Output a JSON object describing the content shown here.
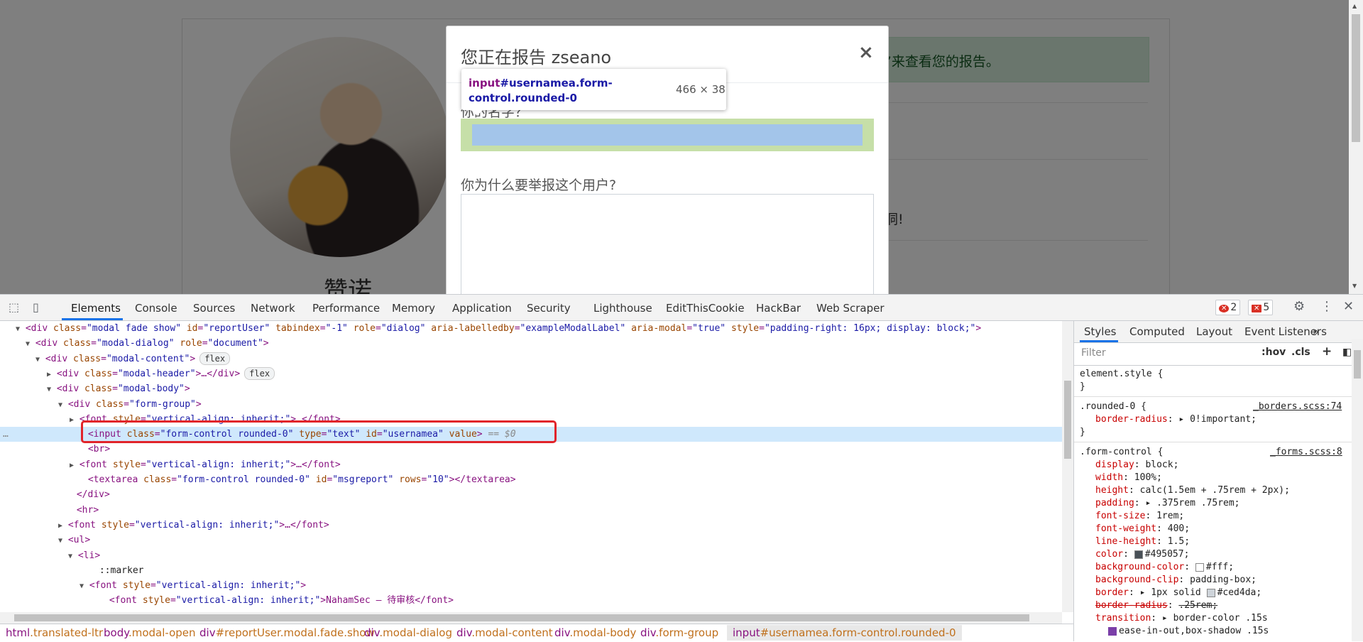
{
  "page": {
    "profile_name": "赞诺",
    "alert_text": "”来查看您的报告。",
    "side_text": "洞!"
  },
  "modal": {
    "title": "您正在报告 zseano",
    "close": "×",
    "label_username": "你的名字？",
    "label_reason": "你为什么要举报这个用户?"
  },
  "tooltip": {
    "tag": "input",
    "selector_rest": "#usernamea.form-control.rounded-0",
    "size": "466 × 38"
  },
  "devtools": {
    "tabs": [
      "Elements",
      "Console",
      "Sources",
      "Network",
      "Performance",
      "Memory",
      "Application",
      "Security",
      "Lighthouse",
      "EditThisCookie",
      "HackBar",
      "Web Scraper"
    ],
    "errors_count": "2",
    "issues_count": "5",
    "selected_marker": "== $0",
    "ellipsis": "…",
    "flex": "flex",
    "breadcrumbs": [
      {
        "tag": "html",
        "cls": ".translated-ltr"
      },
      {
        "tag": "body",
        "cls": ".modal-open"
      },
      {
        "tag": "div",
        "cls": "#reportUser.modal.fade.show"
      },
      {
        "tag": "div",
        "cls": ".modal-dialog"
      },
      {
        "tag": "div",
        "cls": ".modal-content"
      },
      {
        "tag": "div",
        "cls": ".modal-body"
      },
      {
        "tag": "div",
        "cls": ".form-group"
      },
      {
        "tag": "input",
        "cls": "#usernamea.form-control.rounded-0"
      }
    ],
    "dom_lines": [
      "<div class=\"modal fade show\" id=\"reportUser\" tabindex=\"-1\" role=\"dialog\" aria-labelledby=\"exampleModalLabel\" aria-modal=\"true\" style=\"padding-right: 16px; display: block;\">",
      "<div class=\"modal-dialog\" role=\"document\">",
      "<div class=\"modal-content\">",
      "<div class=\"modal-header\">…</div>",
      "<div class=\"modal-body\">",
      "<div class=\"form-group\">",
      "<font style=\"vertical-align: inherit;\">…</font>",
      "<input class=\"form-control rounded-0\" type=\"text\" id=\"usernamea\" value>",
      "<br>",
      "<font style=\"vertical-align: inherit;\">…</font>",
      "<textarea class=\"form-control rounded-0\" id=\"msgreport\" rows=\"10\"></textarea>",
      "</div>",
      "<hr>",
      "<font style=\"vertical-align: inherit;\">…</font>",
      "<ul>",
      "<li>",
      "::marker",
      "<font style=\"vertical-align: inherit;\">",
      "<font style=\"vertical-align: inherit;\">NahamSec – 待审核</font>"
    ]
  },
  "styles": {
    "tabs": [
      "Styles",
      "Computed",
      "Layout",
      "Event Listeners",
      "»"
    ],
    "filter_placeholder": "Filter",
    "hov": ":hov",
    "cls": ".cls",
    "plus": "+",
    "rules": {
      "element_style": "element.style {",
      "close_brace": "}",
      "rounded_selector": ".rounded-0 {",
      "rounded_source": "_borders.scss:74",
      "rounded_prop": "border-radius",
      "rounded_val": "0!important;",
      "fc_selector": ".form-control {",
      "fc_source": "_forms.scss:8",
      "fc_props": [
        {
          "n": "display",
          "v": "block;"
        },
        {
          "n": "width",
          "v": "100%;"
        },
        {
          "n": "height",
          "v": "calc(1.5em + .75rem + 2px);"
        },
        {
          "n": "padding",
          "v": ".375rem .75rem;"
        },
        {
          "n": "font-size",
          "v": "1rem;"
        },
        {
          "n": "font-weight",
          "v": "400;"
        },
        {
          "n": "line-height",
          "v": "1.5;"
        },
        {
          "n": "color",
          "v": "#495057;"
        },
        {
          "n": "background-color",
          "v": "#fff;"
        },
        {
          "n": "background-clip",
          "v": "padding-box;"
        },
        {
          "n": "border",
          "v": "1px solid #ced4da;"
        },
        {
          "n": "border-radius",
          "v": ".25rem;"
        },
        {
          "n": "transition",
          "v": "border-color .15s"
        }
      ],
      "transition_cont": "ease-in-out,box-shadow .15s"
    }
  },
  "colors": {
    "color_swatch": "#495057",
    "bg_swatch": "#ffffff",
    "border_swatch": "#ced4da"
  }
}
